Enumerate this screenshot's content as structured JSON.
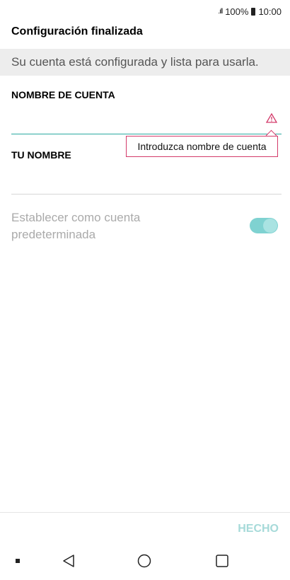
{
  "status_bar": {
    "signal_icon": "signal-icon",
    "battery_percent": "100%",
    "battery_icon": "battery-icon",
    "time": "10:00"
  },
  "header": {
    "title": "Configuración finalizada"
  },
  "info_banner": {
    "text": "Su cuenta está configurada y lista para usarla."
  },
  "form": {
    "account_name_label": "NOMBRE DE CUENTA",
    "account_name_value": "",
    "warning_icon": "warning-icon",
    "error_tooltip": "Introduzca nombre de cuenta",
    "your_name_label": "TU NOMBRE",
    "your_name_value": "",
    "default_account_label": "Establecer como cuenta predeterminada",
    "default_account_enabled": true
  },
  "footer": {
    "done_label": "HECHO"
  },
  "navbar": {
    "icons": [
      "dot-icon",
      "back-icon",
      "home-icon",
      "recent-apps-icon"
    ]
  },
  "colors": {
    "accent": "#2aa9a0",
    "error": "#d33a6a",
    "toggle_track": "#7fd2d1",
    "done_disabled": "#a6dad9"
  }
}
